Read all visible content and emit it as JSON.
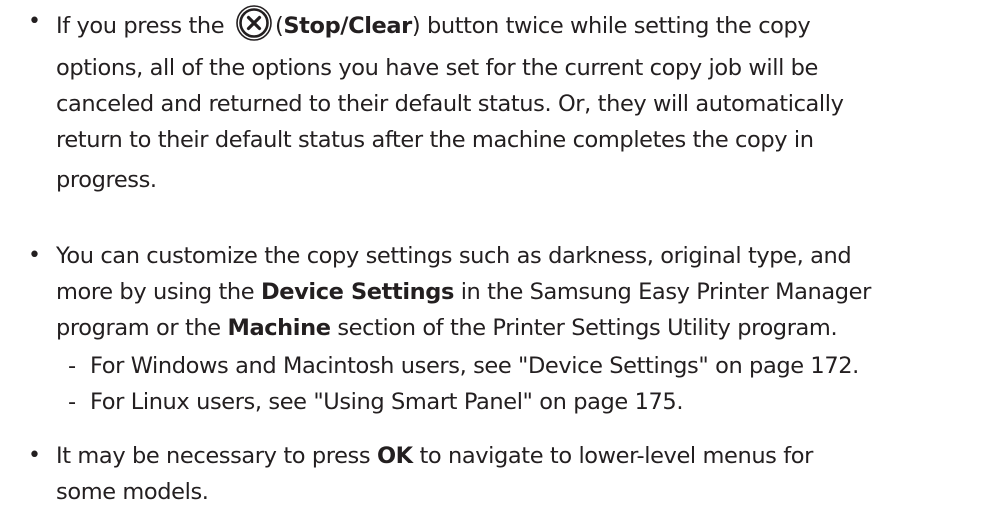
{
  "bullets": {
    "b1": {
      "pre": "If you press the ",
      "button_name": "Stop/Clear",
      "post": " button twice while setting the copy",
      "line2": "options, all of the options you have set for the current copy job will be",
      "line3": "canceled and returned to their default status. Or, they will automatically",
      "line4": "return to their default status after the machine completes the copy in",
      "line5": "progress."
    },
    "b2": {
      "line1": "You can customize the copy settings such as darkness, original type, and",
      "line2_pre": "more by using the ",
      "line2_bold": "Device Settings",
      "line2_post": " in the Samsung Easy Printer Manager",
      "line3_pre": "program or the ",
      "line3_bold": "Machine",
      "line3_post": " section of the Printer Settings Utility program."
    },
    "sub1": "For Windows and Macintosh users, see \"Device Settings\" on page 172.",
    "sub2": "For Linux users, see \"Using Smart Panel\" on page 175.",
    "b3": {
      "pre": "It may be necessary to press ",
      "bold": "OK",
      "post": " to navigate to lower-level menus for",
      "line2": "some models."
    }
  },
  "symbols": {
    "bullet": "•",
    "dash": "-",
    "stop_icon": "stop-clear-x-icon"
  }
}
